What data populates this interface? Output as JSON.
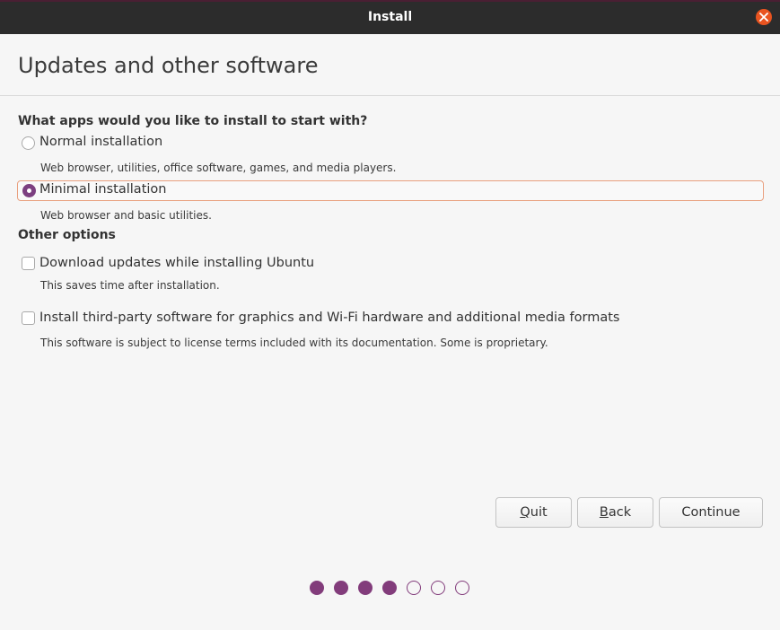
{
  "window": {
    "title": "Install"
  },
  "page": {
    "title": "Updates and other software"
  },
  "apps_section": {
    "heading": "What apps would you like to install to start with?",
    "options": [
      {
        "label": "Normal installation",
        "description": "Web browser, utilities, office software, games, and media players.",
        "selected": false
      },
      {
        "label": "Minimal installation",
        "description": "Web browser and basic utilities.",
        "selected": true
      }
    ]
  },
  "other_section": {
    "heading": "Other options",
    "options": [
      {
        "label": "Download updates while installing Ubuntu",
        "description": "This saves time after installation.",
        "checked": false
      },
      {
        "label": "Install third-party software for graphics and Wi-Fi hardware and additional media formats",
        "description": "This software is subject to license terms included with its documentation. Some is proprietary.",
        "checked": false
      }
    ]
  },
  "buttons": {
    "quit": {
      "mnemonic": "Q",
      "rest": "uit"
    },
    "back": {
      "mnemonic": "B",
      "rest": "ack"
    },
    "continue": {
      "label": "Continue"
    }
  },
  "progress": {
    "current_step": 4,
    "total_steps": 7
  },
  "colors": {
    "accent": "#e95420",
    "progress": "#823c7b",
    "radio_selected": "#7c3f80",
    "titlebar": "#2c2c2c"
  }
}
